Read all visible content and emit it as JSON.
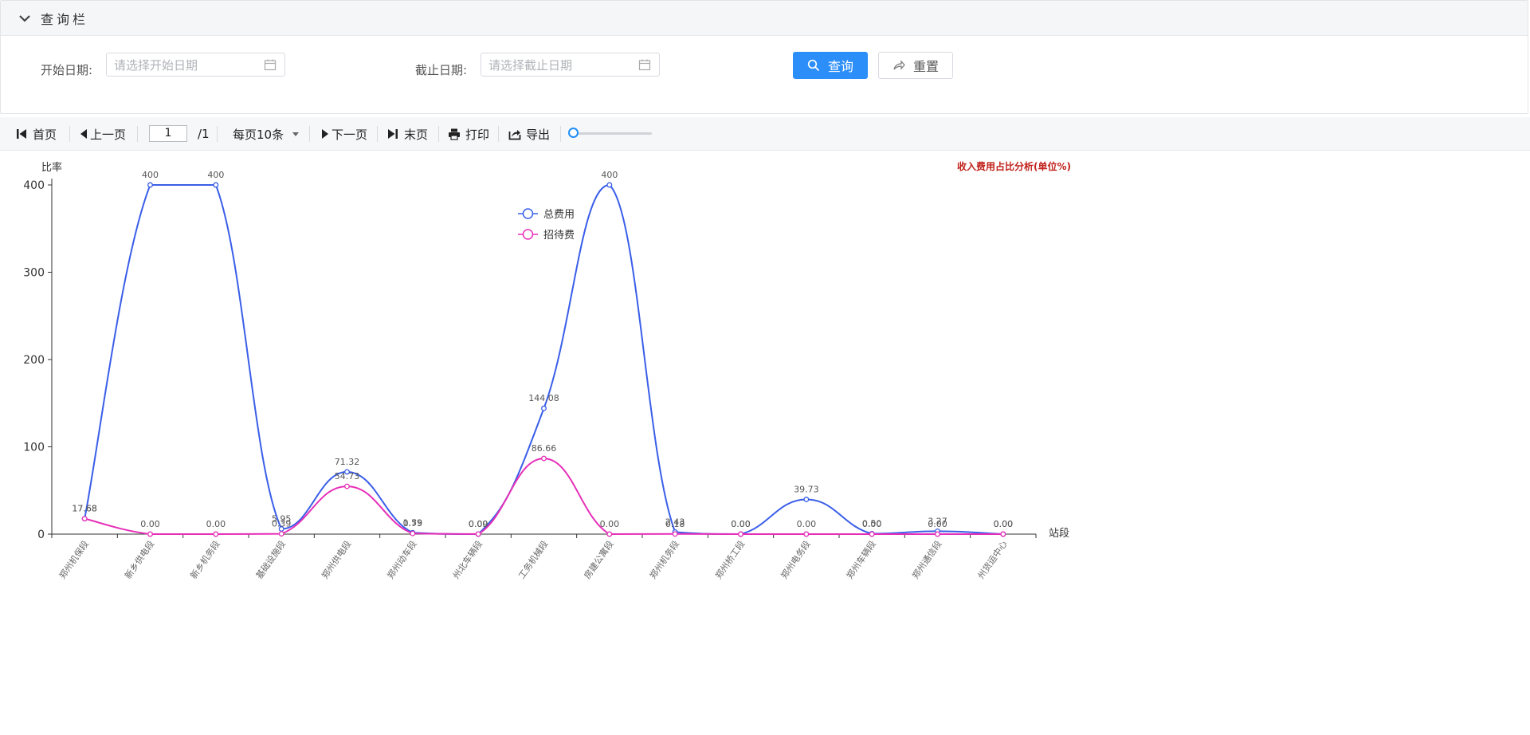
{
  "query": {
    "header_title": "查询栏",
    "start_label": "开始日期:",
    "start_placeholder": "请选择开始日期",
    "end_label": "截止日期:",
    "end_placeholder": "请选择截止日期",
    "search_label": "查询",
    "reset_label": "重置"
  },
  "toolbar": {
    "first": "首页",
    "prev": "上一页",
    "page_value": "1",
    "page_total": "/1",
    "page_size": "每页10条",
    "next": "下一页",
    "last": "末页",
    "print": "打印",
    "export": "导出",
    "zoom_level": 0.05
  },
  "colors": {
    "primary": "#2c8ef8",
    "series_total": "#3a5ee8",
    "series_hosp": "#e62fb8",
    "chart_title": "#c0201a"
  },
  "chart_data": {
    "type": "line",
    "title": "收入费用占比分析(单位%)",
    "ylabel": "比率",
    "xlabel": "站段",
    "ylim": [
      0,
      400
    ],
    "yticks": [
      0,
      100,
      200,
      300,
      400
    ],
    "categories": [
      "郑州机保段",
      "新乡供电段",
      "新乡机务段",
      "基础设施段",
      "郑州供电段",
      "郑州动车段",
      "州北车辆段",
      "工务机械段",
      "房建公寓段",
      "郑州机务段",
      "郑州桥工段",
      "郑州电务段",
      "郑州车辆段",
      "郑州通信段",
      "州货运中心"
    ],
    "series": [
      {
        "name": "总费用",
        "values": [
          17.68,
          400,
          400,
          5.95,
          71.32,
          1.59,
          0.0,
          144.08,
          400,
          2.43,
          0.0,
          39.73,
          0.5,
          3.27,
          0.0
        ],
        "labels": [
          "17.68",
          "400",
          "400",
          "5.95",
          "71.32",
          "1.59",
          "0.00",
          "144.08",
          "400",
          "2.43",
          "0.00",
          "39.73",
          "0.50",
          "3.27",
          "0.00"
        ]
      },
      {
        "name": "招待费",
        "values": [
          17.68,
          0.0,
          0.0,
          0.39,
          54.73,
          0.75,
          0.09,
          86.66,
          0.0,
          0.18,
          0.0,
          0.0,
          0.0,
          0.0,
          0.0
        ],
        "labels": [
          "17.68",
          "0.00",
          "0.00",
          "0.39",
          "54.73",
          "0.75",
          "0.09",
          "86.66",
          "0.00",
          "0.18",
          "0.00",
          "0.00",
          "0.00",
          "0.00",
          "0.00"
        ]
      }
    ],
    "legend_position": "top-center",
    "grid": false
  }
}
